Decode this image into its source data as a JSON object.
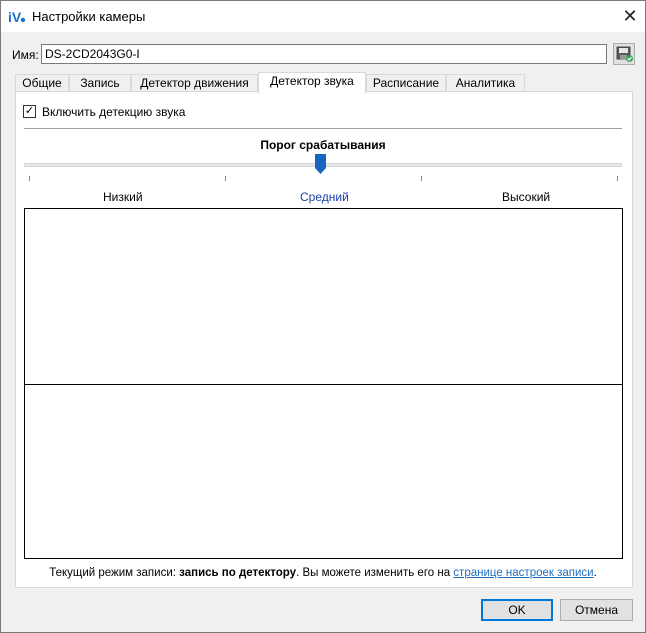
{
  "window": {
    "title": "Настройки камеры",
    "close_glyph": "✕",
    "app_icon": "iv-logo-icon"
  },
  "name_field": {
    "label": "Имя:",
    "value": "DS-2CD2043G0-I",
    "save_icon": "save-to-disk-icon"
  },
  "tabs": [
    {
      "label": "Общие"
    },
    {
      "label": "Запись"
    },
    {
      "label": "Детектор движения"
    },
    {
      "label": "Детектор звука",
      "active": true
    },
    {
      "label": "Расписание"
    },
    {
      "label": "Аналитика"
    }
  ],
  "sound_detector": {
    "enable_label": "Включить детекцию звука",
    "enabled": true,
    "check_glyph": "✓",
    "threshold_title": "Порог срабатывания",
    "threshold_level": 0.5,
    "levels": {
      "low": "Низкий",
      "mid": "Средний",
      "high": "Высокий"
    }
  },
  "status": {
    "prefix": "Текущий режим записи: ",
    "mode": "запись по детектору",
    "middle": ". Вы можете изменить его на ",
    "link": "странице настроек записи",
    "suffix": "."
  },
  "buttons": {
    "ok": "OK",
    "cancel": "Отмена"
  },
  "colors": {
    "accent": "#0078d7",
    "link": "#1f6fbf",
    "slider_thumb": "#1665c0"
  }
}
